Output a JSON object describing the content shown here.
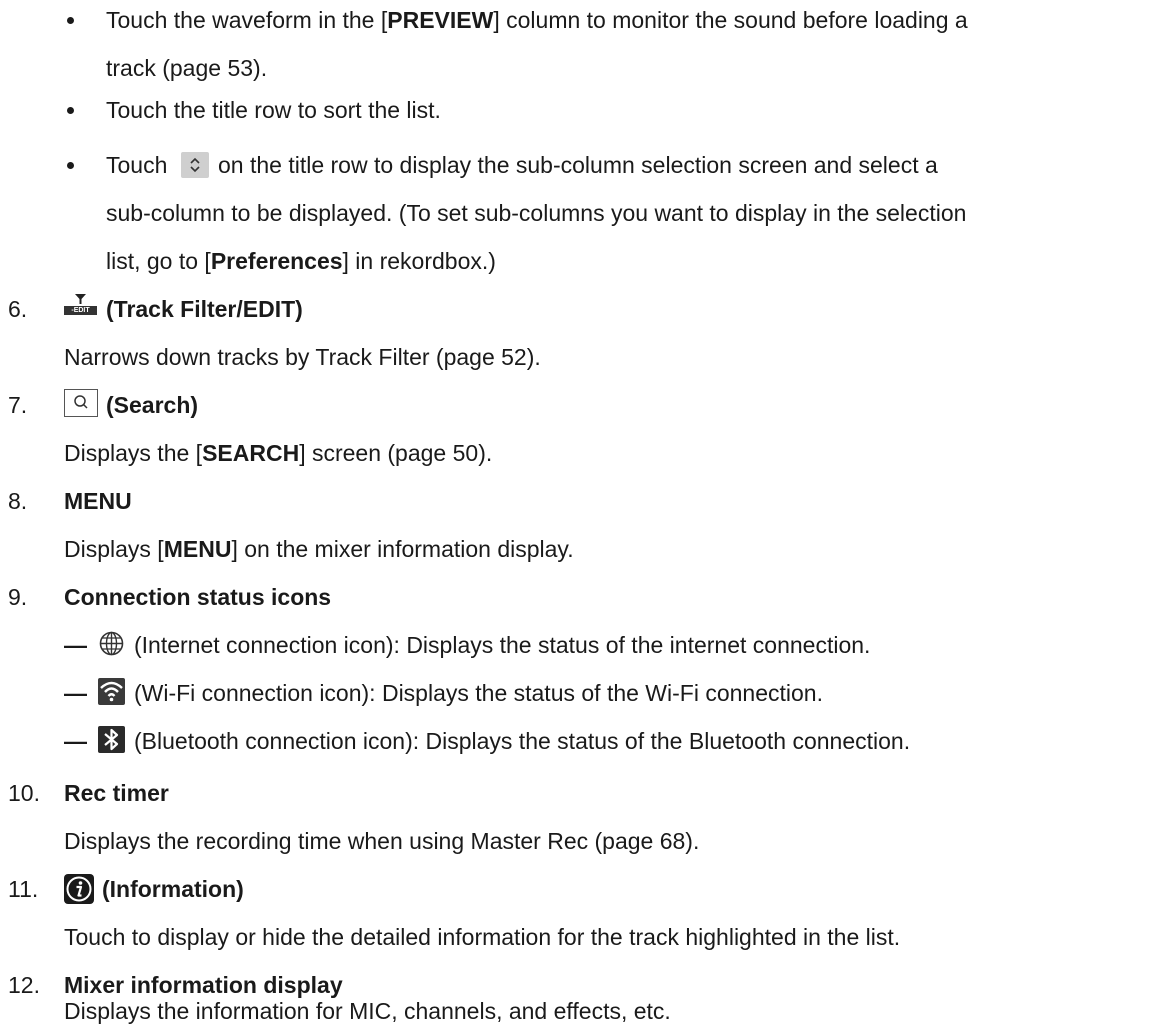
{
  "bullets": [
    {
      "line1_pre": "Touch the waveform in the [",
      "line1_bold": "PREVIEW",
      "line1_post": "] column to monitor the sound before loading a",
      "line2": "track (page 53)."
    },
    {
      "line1": "Touch the title row to sort the list."
    },
    {
      "line1_pre": "Touch",
      "line1_post": "on the title row to display the sub-column selection screen and select a",
      "line2": "sub-column to be displayed. (To set sub-columns you want to display in the selection",
      "line3_pre": "list, go to [",
      "line3_bold": "Preferences",
      "line3_post": "] in rekordbox.)"
    }
  ],
  "items": [
    {
      "number": "6.",
      "title": "(Track Filter/EDIT)",
      "desc": "Narrows down tracks by Track Filter (page 52).",
      "icon": "track-filter-edit-icon",
      "icon_label": "-EDIT"
    },
    {
      "number": "7.",
      "title": "(Search)",
      "desc_pre": "Displays the [",
      "desc_bold": "SEARCH",
      "desc_post": "] screen (page 50).",
      "icon": "search-icon"
    },
    {
      "number": "8.",
      "title": "MENU",
      "desc_pre": "Displays [",
      "desc_bold": "MENU",
      "desc_post": "] on the mixer information display."
    },
    {
      "number": "9.",
      "title": "Connection status icons",
      "subs": [
        {
          "dash": "—",
          "text": "(Internet connection icon): Displays the status of the internet connection.",
          "icon": "globe-icon"
        },
        {
          "dash": "—",
          "text": "(Wi-Fi connection icon): Displays the status of the Wi-Fi connection.",
          "icon": "wifi-icon"
        },
        {
          "dash": "—",
          "text": "(Bluetooth connection icon): Displays the status of the Bluetooth connection.",
          "icon": "bluetooth-icon"
        }
      ]
    },
    {
      "number": "10.",
      "title": "Rec timer",
      "desc": "Displays the recording time when using Master Rec (page 68)."
    },
    {
      "number": "11.",
      "title": "(Information)",
      "desc": "Touch to display or hide the detailed information for the track highlighted in the list.",
      "icon": "information-icon"
    },
    {
      "number": "12.",
      "title": "Mixer information display",
      "desc": "Displays the information for MIC, channels, and effects, etc."
    }
  ]
}
